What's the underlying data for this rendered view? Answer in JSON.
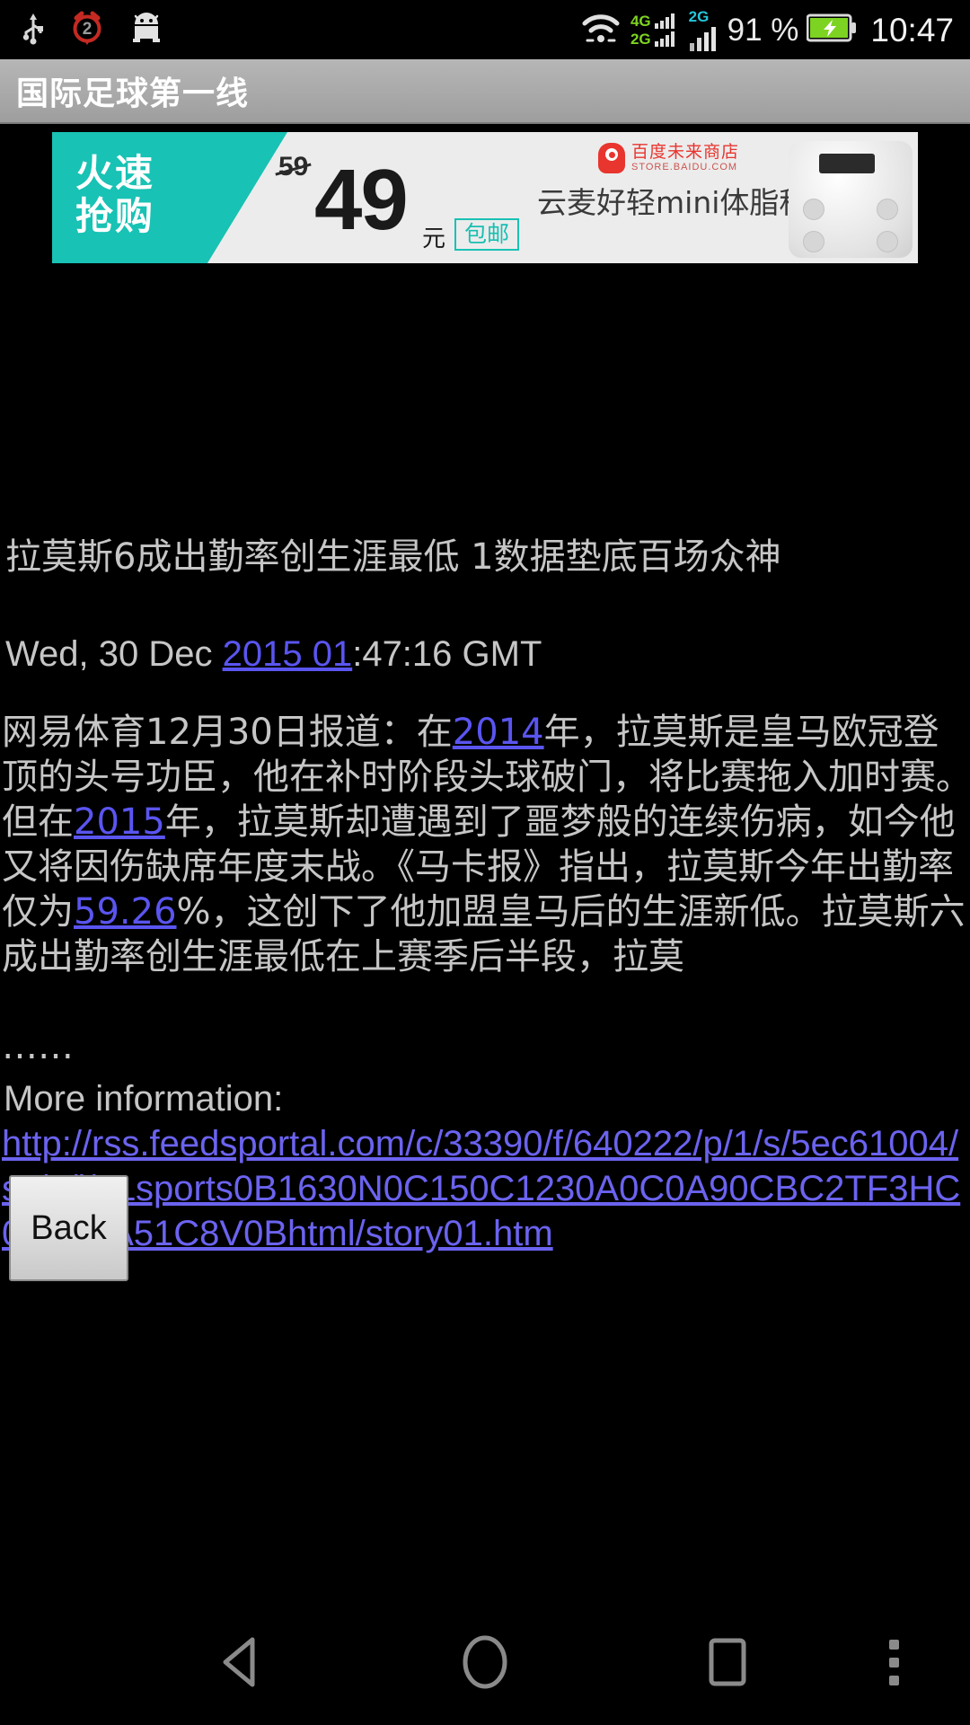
{
  "status_bar": {
    "icons_left": [
      "usb-icon",
      "alarm-clock-icon",
      "android-robot-icon"
    ],
    "alarm_badge": "2",
    "network_labels": {
      "sim1_top": "4G",
      "sim1_bottom": "2G",
      "sim2": "2G"
    },
    "battery_percent": "91 %",
    "clock": "10:47"
  },
  "app_bar": {
    "title": "国际足球第一线"
  },
  "ad": {
    "flash_sale_line1": "火速",
    "flash_sale_line2": "抢购",
    "old_price": "59",
    "price": "49",
    "currency": "元",
    "shipping_badge": "包邮",
    "product": "云麦好轻mini体脂秤",
    "store_cn": "百度未来商店",
    "store_en": "STORE.BAIDU.COM"
  },
  "article": {
    "title": "拉莫斯6成出勤率创生涯最低 1数据垫底百场众神",
    "date_prefix": "Wed, 30 Dec ",
    "date_link": "2015 01",
    "date_suffix": ":47:16 GMT",
    "body_1": "网易体育12月30日报道：在",
    "body_link_1": "2014",
    "body_2": "年，拉莫斯是皇马欧冠登顶的头号功臣，他在补时阶段头球破门，将比赛拖入加时赛。但在",
    "body_link_2": "2015",
    "body_3": "年，拉莫斯却遭遇到了噩梦般的连续伤病，如今他又将因伤缺席年度末战。《马卡报》指出，拉莫斯今年出勤率仅为",
    "body_link_3": "59.26",
    "body_4": "%，这创下了他加盟皇马后的生涯新低。拉莫斯六成出勤率创生涯最低在上赛季后半段，拉莫",
    "body_ellipsis": "……",
    "more_info_label": "More information:",
    "url": "http://rss.feedsportal.com/c/33390/f/640222/p/1/s/5ec61004/sc/3/l/0Lsports0B1630N0C150C1230A0C0A90CBC2TF3HC0A0A0A51C8V0Bhtml/story01.htm"
  },
  "back_button": {
    "label": "Back"
  },
  "nav_bar": {
    "back": "back-triangle-icon",
    "home": "home-circle-icon",
    "recent": "recents-square-icon",
    "menu": "overflow-menu-icon"
  },
  "colors": {
    "link": "#5a55f0",
    "text": "#c6c6c6",
    "app_bar": "#a9a9a9",
    "ad_accent": "#18c2b4",
    "battery_green": "#7dd321"
  }
}
